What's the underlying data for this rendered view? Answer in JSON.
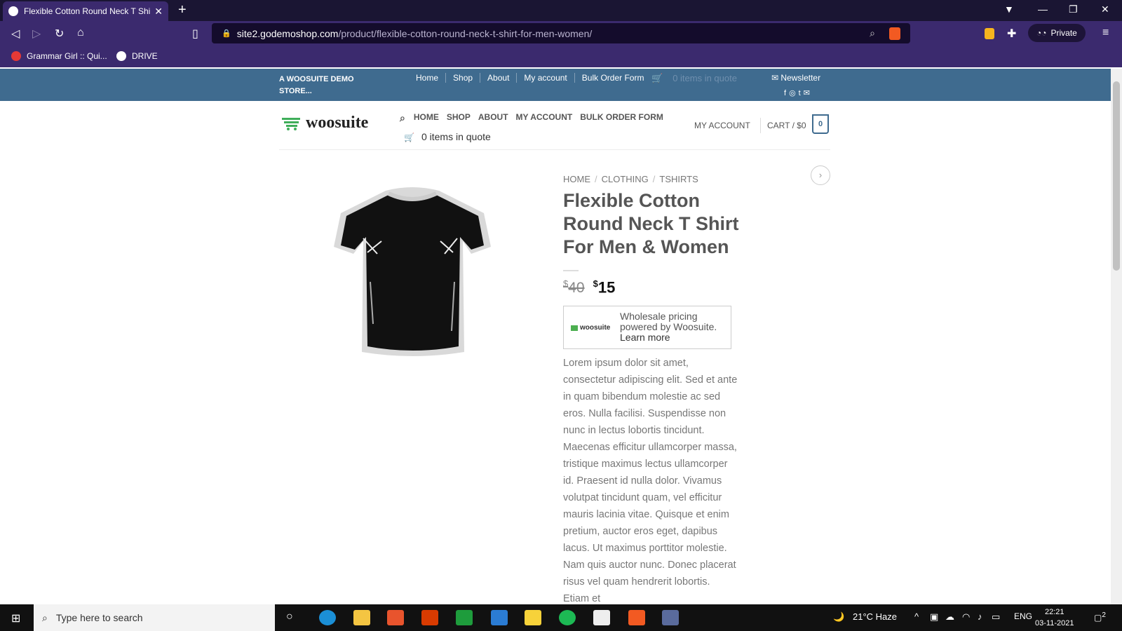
{
  "browser": {
    "tab_title": "Flexible Cotton Round Neck T Shi",
    "url_host": "site2.godemoshop.com",
    "url_path": "/product/flexible-cotton-round-neck-t-shirt-for-men-women/",
    "private_label": "Private",
    "bookmarks": [
      {
        "label": "Grammar Girl :: Qui..."
      },
      {
        "label": "DRIVE"
      }
    ]
  },
  "topbar": {
    "store": "A WOOSUITE DEMO STORE...",
    "nav": [
      "Home",
      "Shop",
      "About",
      "My account",
      "Bulk Order Form"
    ],
    "quote": "0 items in quote",
    "newsletter": "Newsletter"
  },
  "header": {
    "logo": "woosuite",
    "nav": [
      "HOME",
      "SHOP",
      "ABOUT",
      "MY ACCOUNT",
      "BULK ORDER FORM"
    ],
    "quote": "0 items in quote",
    "account": "MY ACCOUNT",
    "cart": "CART / $0",
    "cart_count": "0"
  },
  "product": {
    "breadcrumb": [
      "HOME",
      "CLOTHING",
      "TSHIRTS"
    ],
    "title": "Flexible Cotton Round Neck T Shirt For Men & Women",
    "old_price": "40",
    "new_price": "15",
    "currency": "$",
    "wholesale_logo": "woosuite",
    "wholesale_text": "Wholesale pricing powered by Woosuite.",
    "wholesale_link": "Learn more",
    "description": "Lorem ipsum dolor sit amet, consectetur adipiscing elit. Sed et ante in quam bibendum molestie ac sed eros. Nulla facilisi. Suspendisse non nunc in lectus lobortis tincidunt. Maecenas efficitur ullamcorper massa, tristique maximus lectus ullamcorper id. Praesent id nulla dolor. Vivamus volutpat tincidunt quam, vel efficitur mauris lacinia vitae. Quisque et enim pretium, auctor eros eget, dapibus lacus. Ut maximus porttitor molestie. Nam quis auctor nunc. Donec placerat risus vel quam hendrerit lobortis. Etiam et"
  },
  "taskbar": {
    "search_placeholder": "Type here to search",
    "weather": "21°C  Haze",
    "lang": "ENG",
    "time": "22:21",
    "date": "03-11-2021",
    "notifications": "2"
  }
}
